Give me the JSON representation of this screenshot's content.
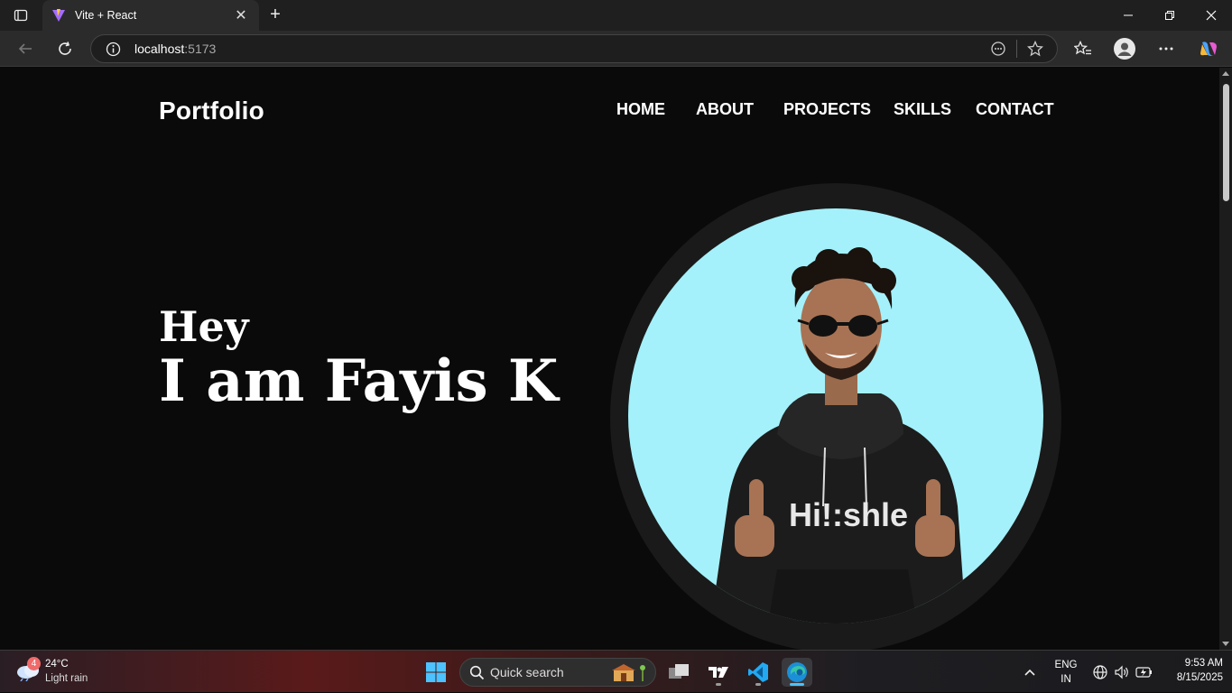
{
  "browser": {
    "tab_title": "Vite + React",
    "tab_close": "✕",
    "new_tab": "+",
    "url_host": "localhost",
    "url_port": ":5173"
  },
  "site": {
    "logo": "Portfolio",
    "nav": [
      "HOME",
      "ABOUT",
      "PROJECTS",
      "SKILLS",
      "CONTACT"
    ],
    "greeting": "Hey",
    "headline": "I am Fayis K",
    "hoodie_text": "Hi!:shle",
    "accent_bg": "#a4f1fb"
  },
  "taskbar": {
    "weather_badge": "4",
    "temperature": "24°C",
    "condition": "Light rain",
    "search_placeholder": "Quick search",
    "lang_1": "ENG",
    "lang_2": "IN",
    "time": "9:53 AM",
    "date": "8/15/2025"
  }
}
